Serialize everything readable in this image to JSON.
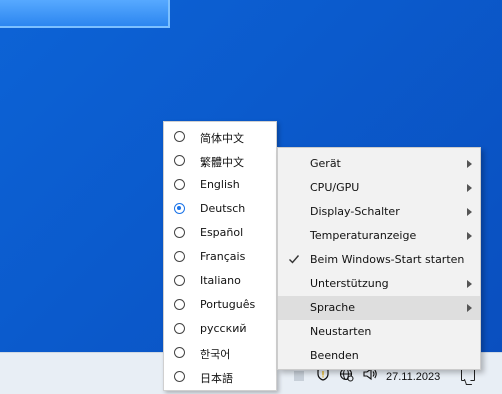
{
  "language_menu": {
    "items": [
      {
        "label": "简体中文",
        "selected": false
      },
      {
        "label": "繁體中文",
        "selected": false
      },
      {
        "label": "English",
        "selected": false
      },
      {
        "label": "Deutsch",
        "selected": true
      },
      {
        "label": "Español",
        "selected": false
      },
      {
        "label": "Français",
        "selected": false
      },
      {
        "label": "Italiano",
        "selected": false
      },
      {
        "label": "Português",
        "selected": false
      },
      {
        "label": "русский",
        "selected": false
      },
      {
        "label": "한국어",
        "selected": false
      },
      {
        "label": "日本語",
        "selected": false
      }
    ]
  },
  "context_menu": {
    "items": [
      {
        "label": "Gerät",
        "submenu": true,
        "checked": false
      },
      {
        "label": "CPU/GPU",
        "submenu": true,
        "checked": false
      },
      {
        "label": "Display-Schalter",
        "submenu": true,
        "checked": false
      },
      {
        "label": "Temperaturanzeige",
        "submenu": true,
        "checked": false
      },
      {
        "label": "Beim Windows-Start starten",
        "submenu": false,
        "checked": true
      },
      {
        "label": "Unterstützung",
        "submenu": true,
        "checked": false
      },
      {
        "label": "Sprache",
        "submenu": true,
        "checked": false,
        "highlighted": true
      },
      {
        "label": "Neustarten",
        "submenu": false,
        "checked": false
      },
      {
        "label": "Beenden",
        "submenu": false,
        "checked": false
      }
    ]
  },
  "taskbar": {
    "date": "27.11.2023",
    "tray_icons": [
      "shield-warning-icon",
      "network-globe-icon",
      "speaker-icon",
      "notification-icon"
    ]
  },
  "colors": {
    "desktop": "#0b5bcd",
    "accent": "#1a73e8",
    "menu_bg": "#f2f2f2",
    "menu_hover": "#dedede"
  }
}
